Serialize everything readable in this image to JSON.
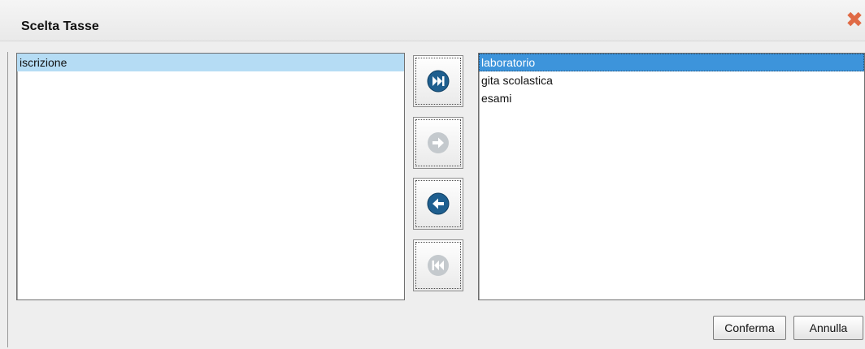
{
  "dialog": {
    "title": "Scelta Tasse",
    "close_icon": "close-x-icon",
    "accent_color": "#3d94db"
  },
  "available_list": {
    "items": [
      "iscrizione"
    ],
    "highlighted_index": 0
  },
  "selected_list": {
    "items": [
      "laboratorio",
      "gita scolastica",
      "esami"
    ],
    "selected_index": 0
  },
  "transfer_buttons": [
    {
      "icon": "move-all-right-icon",
      "enabled": true
    },
    {
      "icon": "move-right-icon",
      "enabled": false
    },
    {
      "icon": "move-left-icon",
      "enabled": true
    },
    {
      "icon": "move-all-left-icon",
      "enabled": false
    }
  ],
  "footer": {
    "confirm_label": "Conferma",
    "cancel_label": "Annulla"
  }
}
